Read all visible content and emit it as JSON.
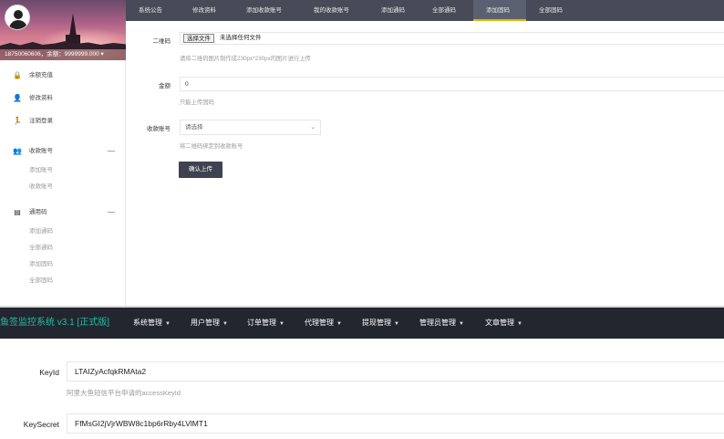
{
  "user": {
    "info": "18750060606，余额：9999999.000",
    "dropdown_glyph": "▾"
  },
  "sidebar": {
    "items": [
      {
        "label": "余额充值",
        "icon": "lock-icon",
        "glyph": "🔒"
      },
      {
        "label": "修改资料",
        "icon": "user-icon",
        "glyph": "👤"
      },
      {
        "label": "注销登录",
        "icon": "running-person-icon",
        "glyph": "🏃"
      },
      {
        "label": "收款账号",
        "icon": "group-icon",
        "glyph": "👥",
        "arrow": "—"
      },
      {
        "label": "通用码",
        "icon": "card-icon",
        "glyph": "▤",
        "arrow": "—"
      }
    ],
    "account_subitems": [
      "添加账号",
      "收款账号"
    ],
    "code_subitems": [
      "添加通码",
      "全部通码",
      "添加固码",
      "全部固码"
    ]
  },
  "navbar": {
    "tabs": [
      "系统公告",
      "修改资料",
      "添加收款账号",
      "我的收款账号",
      "添加通码",
      "全部通码",
      "添加固码",
      "全部固码"
    ],
    "active_index": 6
  },
  "form": {
    "qrcode_label": "二维码",
    "file_button": "选择文件",
    "file_status": "未选择任何文件",
    "qrcode_hint": "请将二维码图片制作成230px*230px的图片进行上传",
    "amount_label": "金额",
    "amount_value": "0",
    "amount_hint": "只能上传固码",
    "account_label": "收款账号",
    "account_placeholder": "请选择",
    "account_hint": "将二维码绑定到收款账号",
    "submit_label": "确认上传"
  },
  "admin": {
    "brand": "鱼签监控系统 v3.1 [正式版]",
    "menu": [
      "系统管理",
      "用户管理",
      "订单管理",
      "代理管理",
      "提现管理",
      "管理员管理",
      "文章管理"
    ],
    "keyid_label": "KeyId",
    "keyid_value": "LTAIZyAcfqkRMAta2",
    "keyid_hint": "阿里大鱼短信平台申请的accessKeyId",
    "keysecret_label": "KeySecret",
    "keysecret_value": "FfMsGI2jVjrWBW8c1bp6rRby4LVlMT1"
  },
  "colors": {
    "top_nav_bg": "#474b57",
    "active_indicator": "#e0b800",
    "submit_bg": "#3f4250",
    "admin_nav_bg": "#23262e",
    "brand_color": "#1dbfa6"
  }
}
